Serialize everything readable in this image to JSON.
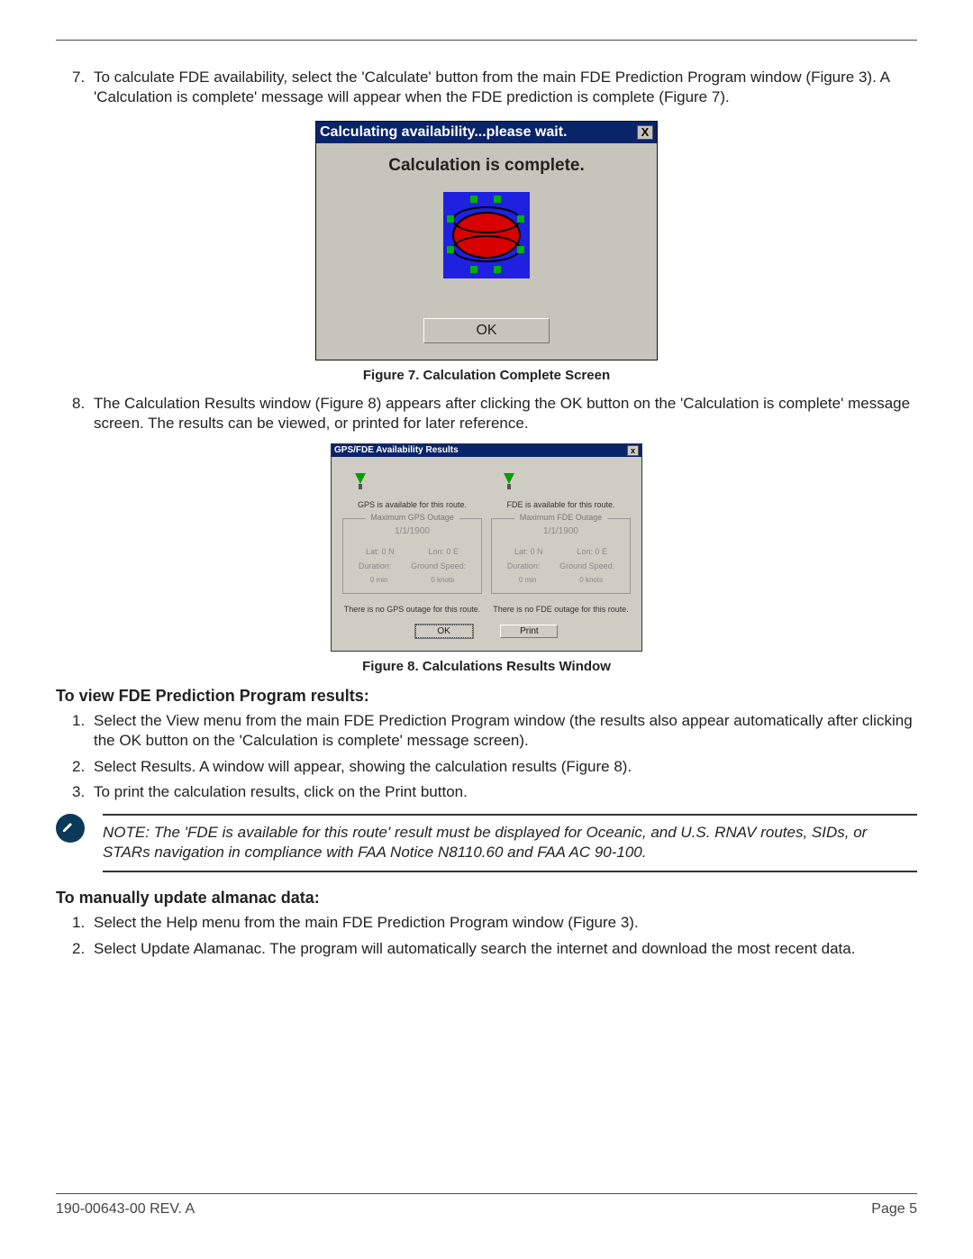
{
  "item7": {
    "num": "7.",
    "text": "To calculate FDE availability, select the 'Calculate' button from the main FDE Prediction Program window (Figure 3). A 'Calculation is complete' message will appear when the FDE prediction is complete (Figure 7)."
  },
  "dlg1": {
    "title": "Calculating availability...please wait.",
    "message": "Calculation is complete.",
    "ok_label": "OK"
  },
  "fig7_caption": "Figure 7. Calculation Complete Screen",
  "item8": {
    "num": "8.",
    "text": "The Calculation Results window (Figure 8) appears after clicking the OK button on the 'Calculation is complete' message screen. The results can be viewed, or printed for later reference."
  },
  "dlg2": {
    "title": "GPS/FDE Availability Results",
    "gps": {
      "avail": "GPS is available for this route.",
      "legend": "Maximum GPS Outage",
      "date": "1/1/1900",
      "lat": "Lat: 0 N",
      "lon": "Lon: 0 E",
      "dur_lbl": "Duration:",
      "dur_val": "0   min",
      "gs_lbl": "Ground Speed:",
      "gs_val": "0   knots",
      "no_outage": "There is no GPS outage for this route."
    },
    "fde": {
      "avail": "FDE is available for this route.",
      "legend": "Maximum FDE Outage",
      "date": "1/1/1900",
      "lat": "Lat: 0 N",
      "lon": "Lon: 0 E",
      "dur_lbl": "Duration:",
      "dur_val": "0   min",
      "gs_lbl": "Ground Speed:",
      "gs_val": "0   knots",
      "no_outage": "There is no FDE outage for this route."
    },
    "ok_label": "OK",
    "print_label": "Print"
  },
  "fig8_caption": "Figure 8. Calculations Results Window",
  "sectionA": {
    "title": "To view FDE Prediction Program results:",
    "i1": {
      "num": "1.",
      "text": "Select the View menu from the main FDE Prediction Program window (the results also appear automatically after clicking the OK button on the 'Calculation is complete' message screen)."
    },
    "i2": {
      "num": "2.",
      "text": "Select Results. A window will appear, showing the calculation results (Figure 8)."
    },
    "i3": {
      "num": "3.",
      "text": "To print the calculation results, click on the Print button."
    }
  },
  "note": {
    "text": "NOTE: The 'FDE is available for this route' result must be displayed for Oceanic, and U.S. RNAV routes, SIDs, or STARs navigation in compliance with FAA Notice N8110.60 and FAA AC 90-100."
  },
  "sectionB": {
    "title": "To manually update almanac data:",
    "i1": {
      "num": "1.",
      "text": "Select the Help menu from the main FDE Prediction Program window (Figure 3)."
    },
    "i2": {
      "num": "2.",
      "text": "Select Update Alamanac. The program will automatically search the internet and download the most recent data."
    }
  },
  "footer": {
    "left": "190-00643-00  REV. A",
    "right": "Page 5"
  }
}
